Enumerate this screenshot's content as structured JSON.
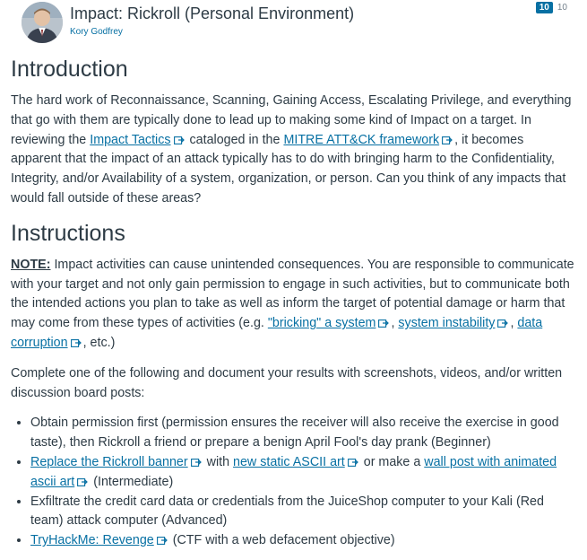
{
  "header": {
    "title": "Impact: Rickroll (Personal Environment)",
    "author": "Kory Godfrey",
    "count_unread": "10",
    "count_total": "10"
  },
  "intro": {
    "heading": "Introduction",
    "text_1": "The hard work of Reconnaissance, Scanning, Gaining Access, Escalating Privilege, and everything that go with them are typically done to lead up to making some kind of Impact on a target. In reviewing the ",
    "link_1": "Impact Tactics",
    "text_2": " cataloged in the ",
    "link_2": "MITRE ATT&CK framework",
    "text_3": ", it becomes apparent that the impact of an attack typically has to do with bringing harm to the Confidentiality, Integrity, and/or Availability of a system, organization, or person. Can you think of any impacts that would fall outside of these areas?"
  },
  "instructions": {
    "heading": "Instructions",
    "note_label": "NOTE:",
    "note_text_1": " Impact activities can cause unintended consequences. You are responsible to communicate with your target and not only gain permission to engage in such activities, but to communicate both the intended actions you plan to take as well as inform the target of potential damage or harm that may come from these types of activities (e.g. ",
    "note_link_1": "\"bricking\" a system",
    "note_text_2": ", ",
    "note_link_2": "system instability",
    "note_text_3": ", ",
    "note_link_3": "data corruption",
    "note_text_4": ", etc.)",
    "complete_text": "Complete one of the following and document your results with screenshots, videos, and/or written discussion board posts:",
    "items": [
      {
        "text": "Obtain permission first (permission ensures the receiver will also receive the exercise in good taste), then Rickroll a friend or prepare a benign April Fool's day prank (Beginner)"
      },
      {
        "link_1": "Replace the Rickroll banner",
        "text_1": " with ",
        "link_2": "new static ASCII art",
        "text_2": " or make a ",
        "link_3": "wall post with animated ascii art",
        "text_3": " (Intermediate)"
      },
      {
        "text": "Exfiltrate the credit card data or credentials from the JuiceShop computer to your Kali (Red team) attack computer (Advanced)"
      },
      {
        "link_1": "TryHackMe: Revenge",
        "text_1": " (CTF with a web defacement objective)"
      }
    ]
  },
  "colors": {
    "link": "#0770a3",
    "text": "#2d3b45",
    "badge": "#0770a3"
  },
  "icons": {
    "external": "external-link-icon",
    "avatar": "avatar"
  }
}
